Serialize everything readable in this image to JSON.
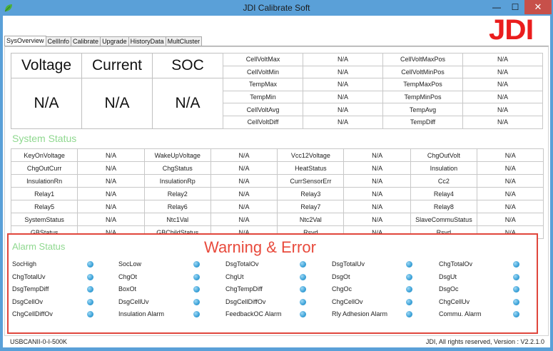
{
  "window": {
    "title": "JDI Calibrate Soft",
    "min": "—",
    "max": "☐",
    "close": "✕"
  },
  "logo": "JDI",
  "tabs": [
    "SysOverview",
    "CellInfo",
    "Calibrate",
    "Upgrade",
    "HistoryData",
    "MultCluster"
  ],
  "kpi": {
    "headers": [
      "Voltage",
      "Current",
      "SOC"
    ],
    "values": [
      "N/A",
      "N/A",
      "N/A"
    ]
  },
  "cell_stats": [
    [
      "CellVoltMax",
      "N/A",
      "CellVoltMaxPos",
      "N/A"
    ],
    [
      "CellVoltMin",
      "N/A",
      "CellVoltMinPos",
      "N/A"
    ],
    [
      "TempMax",
      "N/A",
      "TempMaxPos",
      "N/A"
    ],
    [
      "TempMin",
      "N/A",
      "TempMinPos",
      "N/A"
    ],
    [
      "CellVoltAvg",
      "N/A",
      "TempAvg",
      "N/A"
    ],
    [
      "CellVoltDiff",
      "N/A",
      "TempDiff",
      "N/A"
    ]
  ],
  "system_status": {
    "title": "System Status",
    "rows": [
      [
        "KeyOnVoltage",
        "N/A",
        "WakeUpVoltage",
        "N/A",
        "Vcc12Voltage",
        "N/A",
        "ChgOutVolt",
        "N/A"
      ],
      [
        "ChgOutCurr",
        "N/A",
        "ChgStatus",
        "N/A",
        "HeatStatus",
        "N/A",
        "Insulation",
        "N/A"
      ],
      [
        "InsulationRn",
        "N/A",
        "InsulationRp",
        "N/A",
        "CurrSensorErr",
        "N/A",
        "Cc2",
        "N/A"
      ],
      [
        "Relay1",
        "N/A",
        "Relay2",
        "N/A",
        "Relay3",
        "N/A",
        "Relay4",
        "N/A"
      ],
      [
        "Relay5",
        "N/A",
        "Relay6",
        "N/A",
        "Relay7",
        "N/A",
        "Relay8",
        "N/A"
      ],
      [
        "SystemStatus",
        "N/A",
        "Ntc1Val",
        "N/A",
        "Ntc2Val",
        "N/A",
        "SlaveCommuStatus",
        "N/A"
      ],
      [
        "GBStatus",
        "N/A",
        "GBChildStatus",
        "N/A",
        "Rsvd",
        "N/A",
        "Rsvd",
        "N/A"
      ]
    ]
  },
  "alarm": {
    "title": "Alarm Status",
    "warning_title": "Warning & Error",
    "columns": [
      [
        "SocHigh",
        "ChgTotalUv",
        "DsgTempDiff",
        "DsgCellOv",
        "ChgCellDiffOv"
      ],
      [
        "SocLow",
        "ChgOt",
        "BoxOt",
        "DsgCellUv",
        "Insulation Alarm"
      ],
      [
        "DsgTotalOv",
        "ChgUt",
        "ChgTempDiff",
        "DsgCellDiffOv",
        "FeedbackOC Alarm"
      ],
      [
        "DsgTotalUv",
        "DsgOt",
        "ChgOc",
        "ChgCellOv",
        "Rly Adhesion Alarm"
      ],
      [
        "ChgTotalOv",
        "DsgUt",
        "DsgOc",
        "ChgCellUv",
        "Commu. Alarm"
      ]
    ],
    "led_color": "#3ba2d8"
  },
  "statusbar": {
    "left": "USBCANII-0-I-500K",
    "right": "JDI,  All rights reserved, Version : V2.2.1.0"
  },
  "colors": {
    "title_bar": "#5aa0d8",
    "logo": "#ea1d1d",
    "section_title": "#8fd88f",
    "alarm_border": "#e0463c",
    "warning_text": "#e84a3c"
  }
}
